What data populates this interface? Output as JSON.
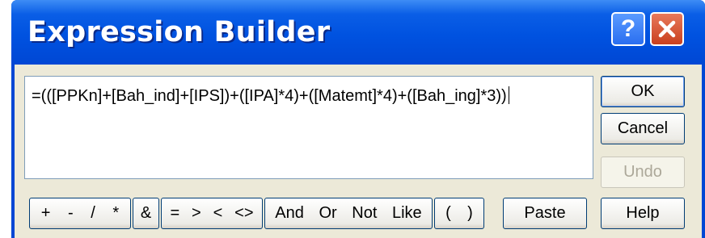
{
  "window": {
    "title": "Expression Builder",
    "help_glyph": "?",
    "colors": {
      "titlebar": "#0047d4",
      "client": "#ece9d8",
      "close": "#c9401e"
    }
  },
  "expression": {
    "text": "=(([PPKn]+[Bah_ind]+[IPS])+([IPA]*4)+([Matemt]*4)+([Bah_ing]*3))"
  },
  "buttons": {
    "ok": "OK",
    "cancel": "Cancel",
    "undo": "Undo",
    "help": "Help",
    "paste": "Paste"
  },
  "operators": {
    "arith": [
      "+",
      "-",
      "/",
      "*"
    ],
    "concat": "&",
    "compare": [
      "=",
      ">",
      "<",
      "<>"
    ],
    "logic": [
      "And",
      "Or",
      "Not",
      "Like"
    ],
    "parens": [
      "(",
      ")"
    ]
  }
}
